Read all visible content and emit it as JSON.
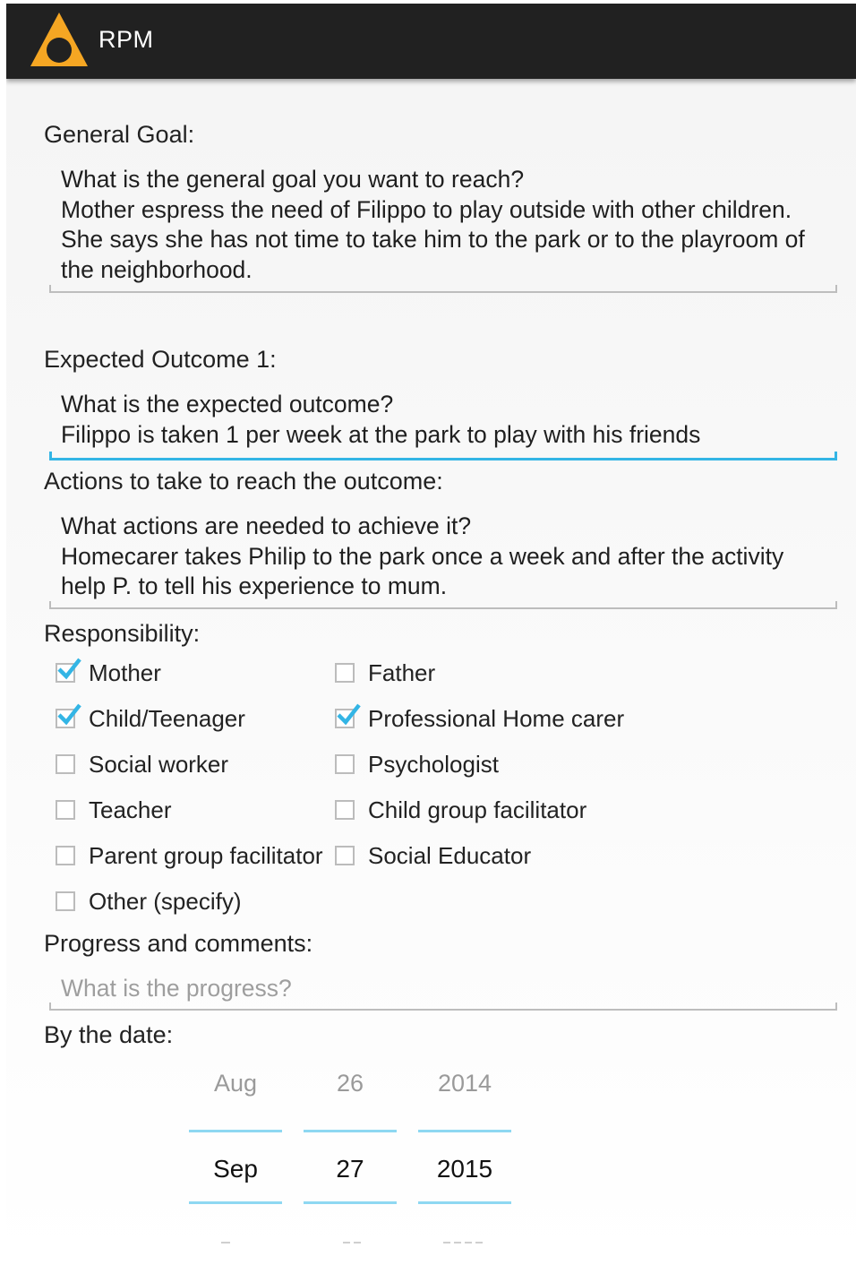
{
  "app": {
    "title": "RPM",
    "icon": "rpm-logo-icon",
    "accent": "#33b5e5",
    "logo_color": "#f5a623"
  },
  "general_goal": {
    "label": "General Goal:",
    "text": "What is the general goal you want to reach?\nMother espress the need of Filippo to play outside with other children. She says she has not time to take him to the park or to the playroom of the neighborhood."
  },
  "expected_outcome": {
    "label": "Expected Outcome 1:",
    "text": "What is the expected outcome?\nFilippo is taken 1 per week at the park to play with his friends"
  },
  "actions": {
    "label": "Actions to take to reach the outcome:",
    "text": "What actions are needed to achieve it?\nHomecarer takes Philip to the park once a week and after the activity help P. to tell his experience to mum."
  },
  "responsibility": {
    "label": "Responsibility:",
    "options": [
      {
        "label": "Mother",
        "checked": true
      },
      {
        "label": "Father",
        "checked": false
      },
      {
        "label": "Child/Teenager",
        "checked": true
      },
      {
        "label": "Professional Home carer",
        "checked": true
      },
      {
        "label": "Social worker",
        "checked": false
      },
      {
        "label": "Psychologist",
        "checked": false
      },
      {
        "label": "Teacher",
        "checked": false
      },
      {
        "label": "Child group facilitator",
        "checked": false
      },
      {
        "label": "Parent group facilitator",
        "checked": false
      },
      {
        "label": "Social Educator",
        "checked": false
      },
      {
        "label": "Other (specify)",
        "checked": false
      }
    ]
  },
  "progress": {
    "label": "Progress and comments:",
    "value": "",
    "placeholder": "What is the progress?"
  },
  "date": {
    "label": "By the date:",
    "prev": {
      "month": "Aug",
      "day": "26",
      "year": "2014"
    },
    "selected": {
      "month": "Sep",
      "day": "27",
      "year": "2015"
    }
  }
}
